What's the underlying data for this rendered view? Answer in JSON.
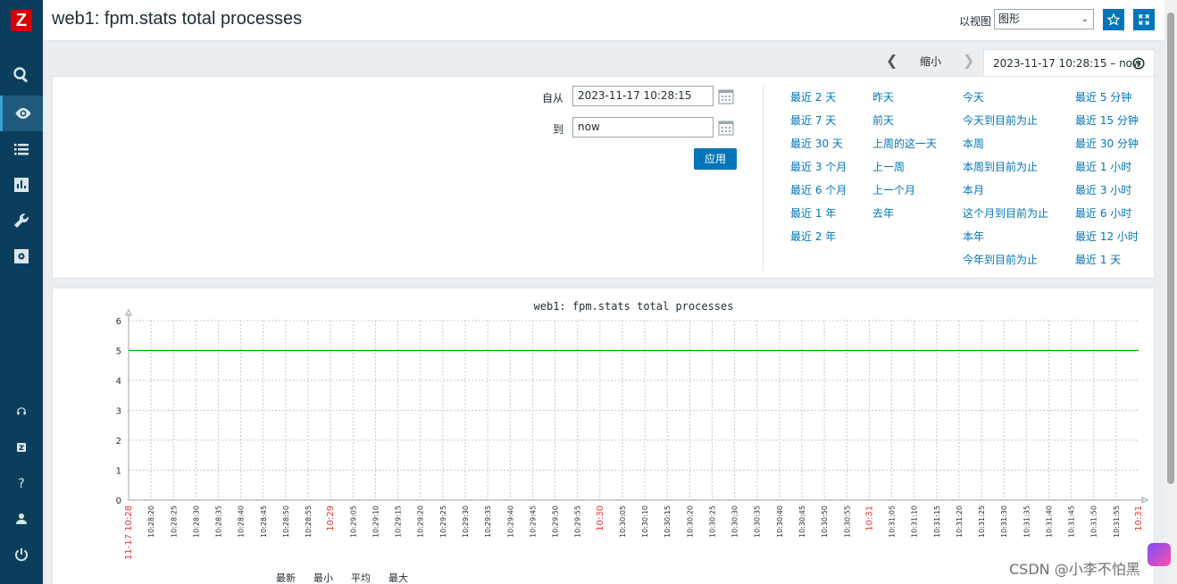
{
  "sidebar": {
    "logo": "Z",
    "icons": [
      "search-icon",
      "eye-icon",
      "list-icon",
      "chart-icon",
      "wrench-icon",
      "gear-icon",
      "headset-icon",
      "zabbix-share-icon",
      "help-icon",
      "user-icon",
      "power-icon"
    ]
  },
  "header": {
    "title": "web1: fpm.stats total processes",
    "view_as_label": "以视图",
    "view_as_value": "图形"
  },
  "time_nav": {
    "zoom_out": "缩小",
    "range": "2023-11-17 10:28:15 – now"
  },
  "filter": {
    "from_label": "自从",
    "from_value": "2023-11-17 10:28:15",
    "to_label": "到",
    "to_value": "now",
    "apply": "应用",
    "quick": [
      [
        "最近 2 天",
        "最近 7 天",
        "最近 30 天",
        "最近 3 个月",
        "最近 6 个月",
        "最近 1 年",
        "最近 2 年"
      ],
      [
        "昨天",
        "前天",
        "上周的这一天",
        "上一周",
        "上一个月",
        "去年"
      ],
      [
        "今天",
        "今天到目前为止",
        "本周",
        "本周到目前为止",
        "本月",
        "这个月到目前为止",
        "本年",
        "今年到目前为止"
      ],
      [
        "最近 5 分钟",
        "最近 15 分钟",
        "最近 30 分钟",
        "最近 1 小时",
        "最近 3 小时",
        "最近 6 小时",
        "最近 12 小时",
        "最近 1 天"
      ]
    ]
  },
  "chart_data": {
    "type": "line",
    "title": "web1: fpm.stats total processes",
    "ylim": [
      0,
      6
    ],
    "yticks": [
      "0",
      "1",
      "2",
      "3",
      "4",
      "5",
      "6"
    ],
    "xticks": [
      "11-17 10:28",
      "10:28:20",
      "10:28:25",
      "10:28:30",
      "10:28:35",
      "10:28:40",
      "10:28:45",
      "10:28:50",
      "10:28:55",
      "10:29",
      "10:29:05",
      "10:29:10",
      "10:29:15",
      "10:29:20",
      "10:29:25",
      "10:29:30",
      "10:29:35",
      "10:29:40",
      "10:29:45",
      "10:29:50",
      "10:29:55",
      "10:30",
      "10:30:05",
      "10:30:10",
      "10:30:15",
      "10:30:20",
      "10:30:25",
      "10:30:30",
      "10:30:35",
      "10:30:40",
      "10:30:45",
      "10:30:50",
      "10:30:55",
      "10:31",
      "10:31:05",
      "10:31:10",
      "10:31:15",
      "10:31:20",
      "10:31:25",
      "10:31:30",
      "10:31:35",
      "10:31:40",
      "10:31:45",
      "10:31:50",
      "10:31:55",
      "10:31"
    ],
    "highlight_ticks": [
      "11-17 10:28",
      "10:29",
      "10:30",
      "10:31"
    ],
    "series": [
      {
        "values": [
          5,
          5
        ],
        "color": "#00aa00"
      }
    ],
    "grid": true,
    "legend_headers": [
      "最新",
      "最小",
      "平均",
      "最大"
    ]
  },
  "watermark": "CSDN @小李不怕黑"
}
